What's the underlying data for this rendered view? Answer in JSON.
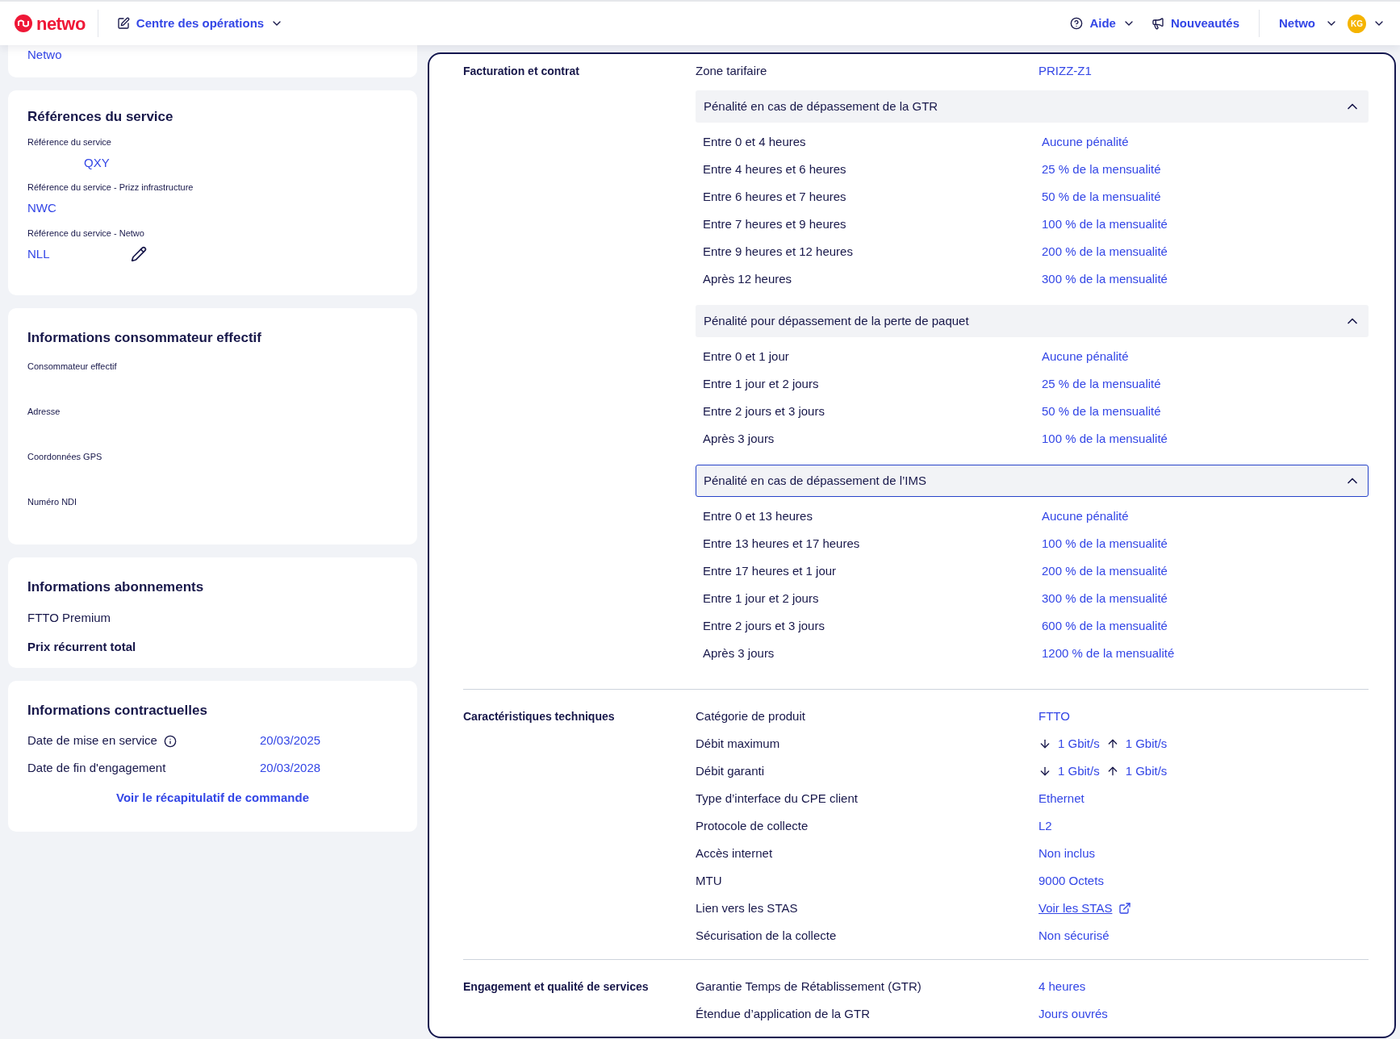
{
  "header": {
    "logo_text": "netwo",
    "nav": {
      "label": "Centre des opérations"
    },
    "help": "Aide",
    "news": "Nouveautés",
    "account": "Netwo",
    "avatar_initials": "KG"
  },
  "left": {
    "top_card": {
      "value": "Netwo"
    },
    "references": {
      "title": "Références du service",
      "fields": [
        {
          "label": "Référence du service",
          "value": "QXY",
          "editable": false
        },
        {
          "label": "Référence du service - Prizz infrastructure",
          "value": "NWC",
          "editable": false
        },
        {
          "label": "Référence du service - Netwo",
          "value": "NLL",
          "editable": true
        }
      ]
    },
    "consumer": {
      "title": "Informations consommateur effectif",
      "fields": [
        {
          "label": "Consommateur effectif"
        },
        {
          "label": "Adresse"
        },
        {
          "label": "Coordonnées GPS"
        },
        {
          "label": "Numéro NDI"
        }
      ]
    },
    "subscriptions": {
      "title": "Informations abonnements",
      "plan": "FTTO Premium",
      "total_label": "Prix récurrent total"
    },
    "contract": {
      "title": "Informations contractuelles",
      "rows": [
        {
          "label": "Date de mise en service",
          "value": "20/03/2025",
          "info": true
        },
        {
          "label": "Date de fin d'engagement",
          "value": "20/03/2028",
          "info": false
        }
      ],
      "link": "Voir le récapitulatif de commande"
    }
  },
  "sections": [
    {
      "title": "Facturation et contrat",
      "items": [
        {
          "kind": "row",
          "label": "Zone tarifaire",
          "value": "PRIZZ-Z1"
        },
        {
          "kind": "accordion",
          "title": "Pénalité en cas de dépassement de la GTR",
          "expanded": true,
          "selected": false,
          "rows": [
            {
              "label": "Entre 0 et 4 heures",
              "value": "Aucune pénalité"
            },
            {
              "label": "Entre 4 heures et 6 heures",
              "value": "25 % de la mensualité"
            },
            {
              "label": "Entre 6 heures et 7 heures",
              "value": "50 % de la mensualité"
            },
            {
              "label": "Entre 7 heures et 9 heures",
              "value": "100 % de la mensualité"
            },
            {
              "label": "Entre 9 heures et 12 heures",
              "value": "200 % de la mensualité"
            },
            {
              "label": "Après 12 heures",
              "value": "300 % de la mensualité"
            }
          ]
        },
        {
          "kind": "accordion",
          "title": "Pénalité pour dépassement de la perte de paquet",
          "expanded": true,
          "selected": false,
          "rows": [
            {
              "label": "Entre 0 et 1 jour",
              "value": "Aucune pénalité"
            },
            {
              "label": "Entre 1 jour et 2 jours",
              "value": "25 % de la mensualité"
            },
            {
              "label": "Entre 2 jours et 3 jours",
              "value": "50 % de la mensualité"
            },
            {
              "label": "Après 3 jours",
              "value": "100 % de la mensualité"
            }
          ]
        },
        {
          "kind": "accordion",
          "title": "Pénalité en cas de dépassement de l’IMS",
          "expanded": true,
          "selected": true,
          "rows": [
            {
              "label": "Entre 0 et 13 heures",
              "value": "Aucune pénalité"
            },
            {
              "label": "Entre 13 heures et 17 heures",
              "value": "100 % de la mensualité"
            },
            {
              "label": "Entre 17 heures et 1 jour",
              "value": "200 % de la mensualité"
            },
            {
              "label": "Entre 1 jour et 2 jours",
              "value": "300 % de la mensualité"
            },
            {
              "label": "Entre 2 jours et 3 jours",
              "value": "600 % de la mensualité"
            },
            {
              "label": "Après 3 jours",
              "value": "1200 % de la mensualité"
            }
          ]
        }
      ]
    },
    {
      "title": "Caractéristiques techniques",
      "items": [
        {
          "kind": "row",
          "label": "Catégorie de produit",
          "value": "FTTO"
        },
        {
          "kind": "speed",
          "label": "Débit maximum",
          "down": "1 Gbit/s",
          "up": "1 Gbit/s"
        },
        {
          "kind": "speed",
          "label": "Débit garanti",
          "down": "1 Gbit/s",
          "up": "1 Gbit/s"
        },
        {
          "kind": "row",
          "label": "Type d’interface du CPE client",
          "value": "Ethernet"
        },
        {
          "kind": "row",
          "label": "Protocole de collecte",
          "value": "L2"
        },
        {
          "kind": "row",
          "label": "Accès internet",
          "value": "Non inclus"
        },
        {
          "kind": "row",
          "label": "MTU",
          "value": "9000 Octets"
        },
        {
          "kind": "link",
          "label": "Lien vers les STAS",
          "value": "Voir les STAS"
        },
        {
          "kind": "row",
          "label": "Sécurisation de la collecte",
          "value": "Non sécurisé"
        }
      ]
    },
    {
      "title": "Engagement et qualité de services",
      "items": [
        {
          "kind": "row",
          "label": "Garantie Temps de Rétablissement (GTR)",
          "value": "4 heures"
        },
        {
          "kind": "row",
          "label": "Étendue d’application de la GTR",
          "value": "Jours ouvrés"
        }
      ]
    }
  ]
}
